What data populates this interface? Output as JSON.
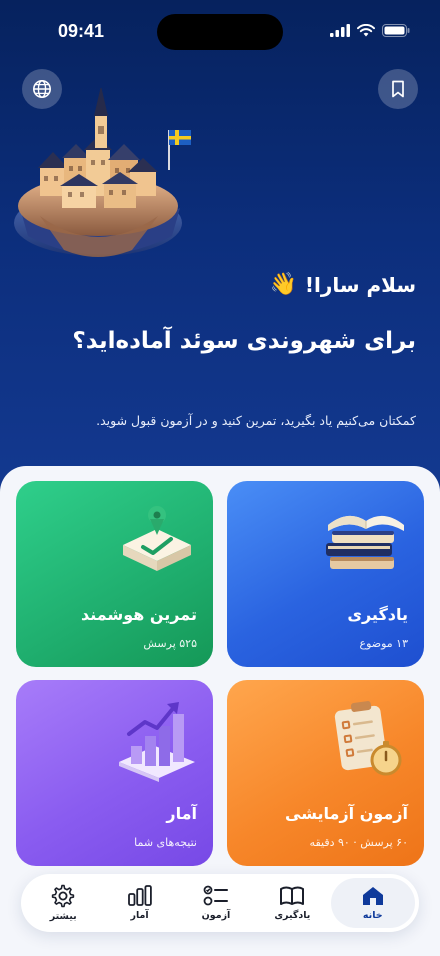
{
  "status_bar": {
    "time": "09:41"
  },
  "header": {
    "greeting": "سلام سارا!",
    "wave_emoji": "👋",
    "headline": "برای شهروندی سوئد آماده‌اید؟",
    "subtitle": "کمکتان می‌کنیم یاد بگیرید، تمرین کنید و در آزمون قبول شوید."
  },
  "cards": [
    {
      "id": "learn",
      "title": "یادگیری",
      "subtitle": "۱۳ موضوع",
      "icon": "books-icon"
    },
    {
      "id": "smart-practice",
      "title": "تمرین هوشمند",
      "subtitle": "۵۲۵ پرسش",
      "icon": "checkmark-target-icon"
    },
    {
      "id": "exam",
      "title": "آزمون آزمایشی",
      "subtitle": "۶۰ پرسش · ۹۰ دقیقه",
      "icon": "clipboard-stopwatch-icon"
    },
    {
      "id": "stats",
      "title": "آمار",
      "subtitle": "نتیجه‌های شما",
      "icon": "bar-chart-icon"
    }
  ],
  "tabbar": {
    "items": [
      {
        "label": "خانه",
        "icon": "home-icon",
        "active": true
      },
      {
        "label": "یادگیری",
        "icon": "book-icon",
        "active": false
      },
      {
        "label": "آزمون",
        "icon": "checklist-icon",
        "active": false
      },
      {
        "label": "آمار",
        "icon": "stats-icon",
        "active": false
      },
      {
        "label": "بیشتر",
        "icon": "gear-icon",
        "active": false
      }
    ]
  },
  "colors": {
    "hero_top": "#06225e",
    "accent_blue": "#2a63e0",
    "accent_green": "#1fae6e",
    "accent_orange": "#f7872a",
    "accent_purple": "#8a5cf0",
    "active_tab": "#0f3a9b"
  }
}
